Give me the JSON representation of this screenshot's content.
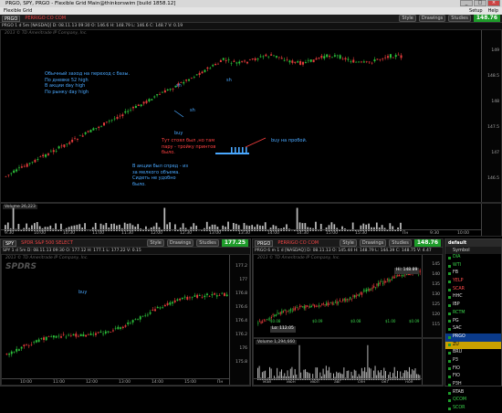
{
  "window": {
    "title": "PRGO, SPY, PRGO - Flexible Grid Main@thinkorswim [build 1858.12]",
    "menu_label": "Flexible Grid",
    "menu_right": [
      "Setup",
      "Help"
    ]
  },
  "top_chart": {
    "symbol": "PRGO",
    "description": "PERRIGO CO COM",
    "style_label": "Style",
    "drawings_label": "Drawings",
    "studies_label": "Studies",
    "last_price": "148.76",
    "quote_line": "PRGO 1 d 5m [NASDAQ] D: 08.11.13 09:30 O: 146.6 H: 148.79 L: 146.6 C: 148.7 V: 0.19",
    "watermark": "2013 © TD Ameritrade IP Company, Inc.",
    "price_ticks": [
      "149",
      "148.5",
      "148",
      "147.5",
      "147",
      "146.5",
      "146"
    ],
    "time_ticks": [
      "9:30",
      "10:00",
      "10:30",
      "11:00",
      "11:30",
      "12:00",
      "12:30",
      "13:00",
      "13:30",
      "14:00",
      "14:30",
      "15:00",
      "15:30",
      "Пн",
      "9:30",
      "10:00"
    ],
    "volume_label": "Volume 26,223",
    "annotations": {
      "main_text": [
        "Обычный заход на переход с базы.",
        "По дневке 52 high",
        "В акции day high",
        "По рынку day high"
      ],
      "sh1": "sh",
      "sh2": "sh",
      "sh3": "sh",
      "buy1": "buy",
      "red_note": [
        "Тут стоял был ,но там",
        "пару - тройку принтов",
        "было."
      ],
      "blue_note": [
        "В акции был спред - из",
        "за мелкого объема.",
        "Сидеть не удобно",
        "было."
      ],
      "buy_breakout": "buy на пробой."
    }
  },
  "spy_chart": {
    "symbol": "SPY",
    "description": "SPDR S&P 500 SELECT",
    "style_label": "Style",
    "drawings_label": "Drawings",
    "studies_label": "Studies",
    "last_price": "177.25",
    "quote_line": "SPY 1 d 5m D: 08.11.13 09:30 O: 177.12 H: 177.1 L: 177.22 V: 0.15",
    "watermark": "2013 © TD Ameritrade IP Company, Inc.",
    "logo": "SPDRS",
    "annotation": "buy",
    "price_ticks": [
      "177.2",
      "177",
      "176.8",
      "176.6",
      "176.4",
      "176.2",
      "176",
      "175.8",
      "175.6"
    ],
    "time_ticks": [
      "10:00",
      "11:00",
      "12:00",
      "13:00",
      "14:00",
      "15:00",
      "Пн"
    ]
  },
  "prgo_daily": {
    "symbol": "PRGO",
    "description": "PERRIGO CO COM",
    "style_label": "Style",
    "drawings_label": "Drawings",
    "studies_label": "Studies",
    "last_price": "148.76",
    "quote_line": "PRGO 6 m 1 d [NASDAQ] D: 08.11.13 O: 145.44 H: 148.79 L: 144.39 C: 148.75 V: 4.47",
    "watermark": "2013 © TD Ameritrade IP Company, Inc.",
    "hi_label": "Hi: 148.89",
    "lo_label": "Lo: 112.05",
    "dividend_labels": [
      "$0.08",
      "$0.09",
      "$0.08",
      "$1.00",
      "$0.09"
    ],
    "volume_label": "Volume 1,294,660",
    "price_ticks": [
      "145",
      "140",
      "135",
      "130",
      "125",
      "120",
      "115",
      "110"
    ],
    "time_ticks": [
      "май",
      "июн",
      "июл",
      "авг",
      "сен",
      "окт",
      "ноя"
    ]
  },
  "watchlist": {
    "title": "default",
    "header": "Symbol",
    "items": [
      {
        "symbol": "DIA",
        "style": "green-t"
      },
      {
        "symbol": "WTI",
        "style": "green-t"
      },
      {
        "symbol": "FB",
        "style": ""
      },
      {
        "symbol": "YELP",
        "style": "red-t"
      },
      {
        "symbol": "SCAR",
        "style": "red-t"
      },
      {
        "symbol": "HHC",
        "style": ""
      },
      {
        "symbol": "IBP",
        "style": ""
      },
      {
        "symbol": "RCTM",
        "style": "green-t"
      },
      {
        "symbol": "PG",
        "style": ""
      },
      {
        "symbol": "SAC",
        "style": ""
      },
      {
        "symbol": "PRGO",
        "style": "sel"
      },
      {
        "symbol": "ZU",
        "style": "hl"
      },
      {
        "symbol": "BRU",
        "style": ""
      },
      {
        "symbol": "P3",
        "style": ""
      },
      {
        "symbol": "FIO",
        "style": ""
      },
      {
        "symbol": "FIO",
        "style": ""
      },
      {
        "symbol": "P3H",
        "style": ""
      },
      {
        "symbol": "RTAB",
        "style": ""
      },
      {
        "symbol": "QCOM",
        "style": "green-t"
      },
      {
        "symbol": "SCOR",
        "style": "green-t"
      }
    ]
  },
  "colors": {
    "up": "#2bbf3a",
    "down": "#e23b3b",
    "annotation_blue": "#4aa8ff",
    "annotation_red": "#ff4040",
    "price_tag": "#1e9c2a"
  }
}
